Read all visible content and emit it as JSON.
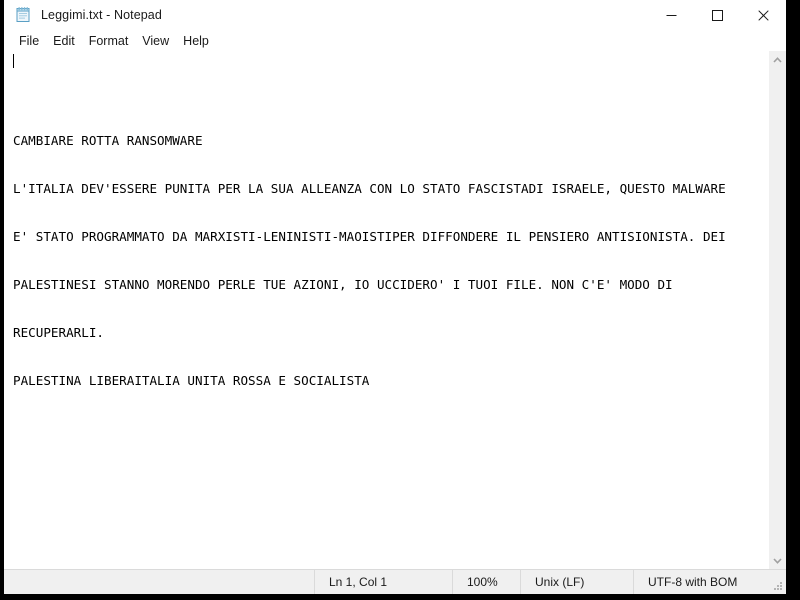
{
  "window": {
    "title": "Leggimi.txt - Notepad",
    "icon": "notepad-icon",
    "controls": {
      "minimize_label": "—",
      "maximize_label": "☐",
      "close_label": "✕"
    }
  },
  "menu": {
    "items": [
      {
        "label": "File"
      },
      {
        "label": "Edit"
      },
      {
        "label": "Format"
      },
      {
        "label": "View"
      },
      {
        "label": "Help"
      }
    ]
  },
  "editor": {
    "lines": [
      "",
      "CAMBIARE ROTTA RANSOMWARE",
      "L'ITALIA DEV'ESSERE PUNITA PER LA SUA ALLEANZA CON LO STATO FASCISTADI ISRAELE, QUESTO MALWARE",
      "E' STATO PROGRAMMATO DA MARXISTI-LENINISTI-MAOISTIPER DIFFONDERE IL PENSIERO ANTISIONISTA. DEI",
      "PALESTINESI STANNO MORENDO PERLE TUE AZIONI, IO UCCIDERO' I TUOI FILE. NON C'E' MODO DI",
      "RECUPERARLI.",
      "PALESTINA LIBERAITALIA UNITA ROSSA E SOCIALISTA"
    ],
    "text_color": "#000000",
    "background": "#ffffff"
  },
  "scrollbar": {
    "up_arrow": "⌃",
    "down_arrow": "⌄"
  },
  "status_bar": {
    "cursor_position": "Ln 1, Col 1",
    "zoom": "100%",
    "line_ending": "Unix (LF)",
    "encoding": "UTF-8 with BOM"
  }
}
